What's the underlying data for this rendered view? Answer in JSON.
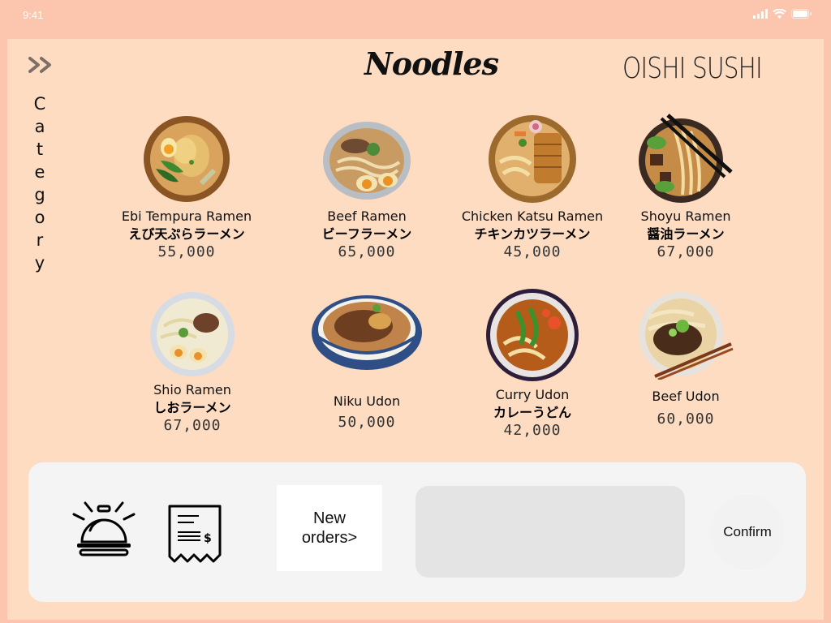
{
  "status": {
    "time": "9:41"
  },
  "header": {
    "category_label": "Category",
    "category_letters": [
      "C",
      "a",
      "t",
      "e",
      "g",
      "o",
      "r",
      "y"
    ],
    "title": "Noodles",
    "brand": "OISHI SUSHI"
  },
  "menu": {
    "items": [
      {
        "name_en": "Ebi Tempura Ramen",
        "name_jp": "えび天ぷらラーメン",
        "price": "55,000"
      },
      {
        "name_en": "Beef Ramen",
        "name_jp": "ビーフラーメン",
        "price": "65,000"
      },
      {
        "name_en": "Chicken Katsu Ramen",
        "name_jp": "チキンカツラーメン",
        "price": "45,000"
      },
      {
        "name_en": "Shoyu Ramen",
        "name_jp": "醤油ラーメン",
        "price": "67,000"
      },
      {
        "name_en": "Shio Ramen",
        "name_jp": "しおラーメン",
        "price": "67,000"
      },
      {
        "name_en": "Niku Udon",
        "name_jp": "",
        "price": "50,000"
      },
      {
        "name_en": "Curry Udon",
        "name_jp": "カレーうどん",
        "price": "42,000"
      },
      {
        "name_en": "Beef Udon",
        "name_jp": "",
        "price": "60,000"
      }
    ]
  },
  "bottom": {
    "new_orders_line1": "New",
    "new_orders_line2": "orders>",
    "confirm_label": "Confirm"
  },
  "icons": {
    "expand": "double-chevron-right-icon",
    "call": "service-bell-icon",
    "bill": "receipt-icon"
  },
  "colors": {
    "outer_background": "#fbc6ad",
    "screen_background": "#fedcc2",
    "panel_background": "#f4f4f4",
    "order_display": "#e4e4e4"
  }
}
